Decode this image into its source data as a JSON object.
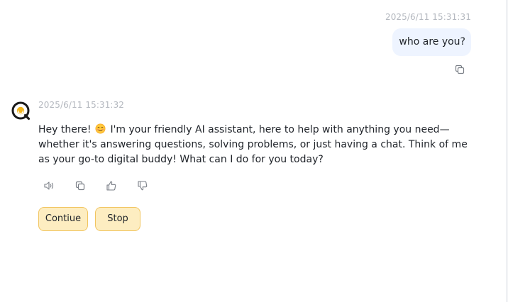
{
  "conversation": {
    "user_message": {
      "timestamp": "2025/6/11 15:31:31",
      "text": "who are you?",
      "copy_icon": "copy-icon"
    },
    "assistant_message": {
      "timestamp": "2025/6/11 15:31:32",
      "avatar_icon": "assistant-logo-icon",
      "text_before_emoji": "Hey there!",
      "emoji": "smiling-face-emoji",
      "text_after_emoji": "I'm your friendly AI assistant, here to help with anything you need—whether it's answering questions, solving problems, or just having a chat. Think of me as your go-to digital buddy! What can I do for you today?",
      "actions": [
        {
          "name": "read-aloud",
          "icon": "speaker-icon"
        },
        {
          "name": "copy",
          "icon": "copy-icon"
        },
        {
          "name": "like",
          "icon": "thumbs-up-icon"
        },
        {
          "name": "dislike",
          "icon": "thumbs-down-icon"
        }
      ]
    },
    "quick_buttons": {
      "continue_label": "Contiue",
      "stop_label": "Stop"
    }
  },
  "colors": {
    "user_bubble_bg": "#eef4ff",
    "timestamp_text": "#b4b8bf",
    "quick_button_bg": "#fdedc1",
    "quick_button_border": "#f1c560",
    "avatar_accent": "#f2b51e"
  }
}
